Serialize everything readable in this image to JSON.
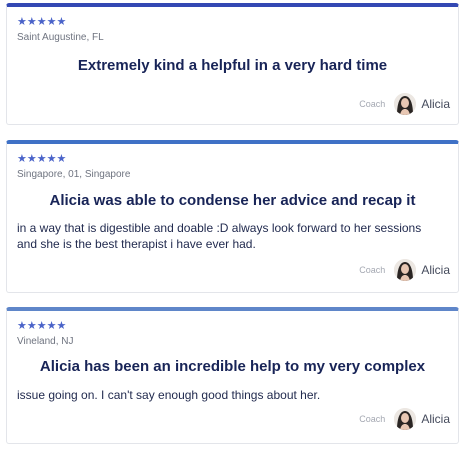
{
  "reviews": [
    {
      "stars": "★★★★★",
      "location": "Saint Augustine, FL",
      "headline": "Extremely kind a helpful in a very hard time",
      "body": "",
      "coach_label": "Coach",
      "coach_name": "Alicia"
    },
    {
      "stars": "★★★★★",
      "location": "Singapore, 01, Singapore",
      "headline": "Alicia was able to condense her advice and recap it",
      "body": "in a way that is digestible and doable :D always look forward to her sessions and she is the best therapist i have ever had.",
      "coach_label": "Coach",
      "coach_name": "Alicia"
    },
    {
      "stars": "★★★★★",
      "location": "Vineland, NJ",
      "headline": "Alicia has been an incredible help to my very complex",
      "body": "issue going on. I can't say enough good things about her.",
      "coach_label": "Coach",
      "coach_name": "Alicia"
    }
  ],
  "colors": {
    "star": "#4a63c9",
    "headline": "#182457",
    "card_border_top": [
      "#3348b3",
      "#3f71c6",
      "#5f86c9"
    ]
  }
}
